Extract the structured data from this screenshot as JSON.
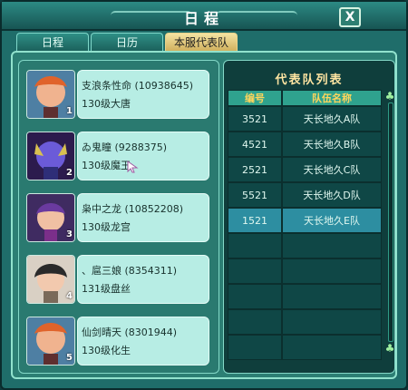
{
  "window": {
    "title": "日程",
    "close_label": "X"
  },
  "tabs": [
    {
      "label": "日程",
      "active": false
    },
    {
      "label": "日历",
      "active": false
    },
    {
      "label": "本服代表队",
      "active": true
    }
  ],
  "team_members": [
    {
      "seat": "1",
      "name": "支浪条性命 (10938645)",
      "level_class": "130级大唐"
    },
    {
      "seat": "2",
      "name": "ゐ鬼瞳 (9288375)",
      "level_class": "130级魔王"
    },
    {
      "seat": "3",
      "name": "枭中之龙 (10852208)",
      "level_class": "130级龙宫"
    },
    {
      "seat": "4",
      "name": "、扈三娘 (8354311)",
      "level_class": "131级盘丝"
    },
    {
      "seat": "5",
      "name": "仙剑晴天 (8301944)",
      "level_class": "130级化生"
    }
  ],
  "team_list": {
    "title": "代表队列表",
    "headers": [
      "编号",
      "队伍名称"
    ],
    "rows": [
      {
        "id": "3521",
        "name": "天长地久A队"
      },
      {
        "id": "4521",
        "name": "天长地久B队"
      },
      {
        "id": "2521",
        "name": "天长地久C队"
      },
      {
        "id": "5521",
        "name": "天长地久D队"
      },
      {
        "id": "1521",
        "name": "天长地久E队"
      }
    ],
    "selected_index": 4
  },
  "colors": {
    "window_bg": "#1f6d6a",
    "tab_active": "#f3e3a1",
    "member_card": "#b7ede4",
    "table_header": "#2fa28e",
    "selected_row": "#2d8ea1",
    "list_title": "#ffe5a2"
  },
  "icons": {
    "close": "close-icon",
    "scroll_up": "scroll-up-icon",
    "scroll_down": "scroll-down-icon"
  }
}
